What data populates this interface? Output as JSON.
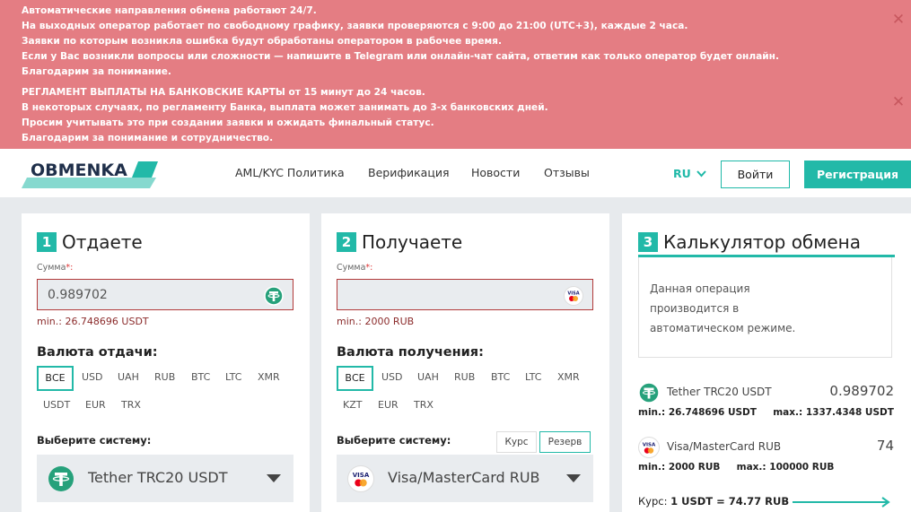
{
  "alerts": [
    {
      "lines": [
        "Автоматические направления обмена работают 24/7.",
        "На выходных оператор работает по свободному графику, заявки проверяются с 9:00 до 21:00 (UTC+3), каждые 2 часа.",
        "Заявки по которым возникла ошибка будут обработаны оператором в рабочее время.",
        "Если у Вас возникли вопросы или сложности — напишите в Telegram или онлайн-чат сайта, ответим как только оператор будет онлайн.",
        "Благодарим за понимание."
      ],
      "close": "✕"
    },
    {
      "lines": [
        "РЕГЛАМЕНТ ВЫПЛАТЫ НА БАНКОВСКИЕ КАРТЫ от 15 минут до 24 часов.",
        "В некоторых случаях, по регламенту Банка, выплата может занимать до 3-х банковских дней.",
        "Просим учитывать это при создании заявки и ожидать финальный статус.",
        "Благодарим за понимание и сотрудничество."
      ],
      "close": "✕"
    }
  ],
  "header": {
    "logo_text": "OBMENKA",
    "nav": [
      "AML/KYC Политика",
      "Верификация",
      "Новости",
      "Отзывы"
    ],
    "lang": "RU",
    "login": "Войти",
    "register": "Регистрация"
  },
  "give": {
    "step": "1",
    "title": "Отдаете",
    "sum_label": "Сумма",
    "required_mark": "*:",
    "amount": "0.989702",
    "min": "min.: 26.748696 USDT",
    "currency_heading": "Валюта отдачи:",
    "chips": [
      "ВСЕ",
      "USD",
      "UAH",
      "RUB",
      "BTC",
      "LTC",
      "XMR",
      "USDT",
      "EUR",
      "TRX"
    ],
    "system_label": "Выберите систему:",
    "selected_system": "Tether TRC20 USDT"
  },
  "receive": {
    "step": "2",
    "title": "Получаете",
    "sum_label": "Сумма",
    "required_mark": "*:",
    "amount": "",
    "min": "min.: 2000 RUB",
    "currency_heading": "Валюта получения:",
    "chips": [
      "ВСЕ",
      "USD",
      "UAH",
      "RUB",
      "BTC",
      "LTC",
      "XMR",
      "KZT",
      "EUR",
      "TRX"
    ],
    "system_label": "Выберите систему:",
    "tab_rate": "Курс",
    "tab_reserve": "Резерв",
    "selected_system": "Visa/MasterCard RUB",
    "visa_text": "VISA"
  },
  "calculator": {
    "step": "3",
    "title": "Калькулятор обмена",
    "note": "Данная операция производится в автоматическом режиме.",
    "give_name": "Tether TRC20 USDT",
    "give_amount": "0.989702",
    "give_limits": "min.: 26.748696 USDT     max.: 1337.4348 USDT",
    "get_name": "Visa/MasterCard RUB",
    "get_amount": "74",
    "get_limits": "min.: 2000 RUB     max.: 100000 RUB",
    "rate_prefix": "Курс:",
    "rate_value": "1 USDT = 74.77 RUB"
  },
  "colors": {
    "accent": "#22b9a8",
    "alert_bg": "#e47d83",
    "error_border": "#b23a3a",
    "tether": "#26a17b"
  }
}
